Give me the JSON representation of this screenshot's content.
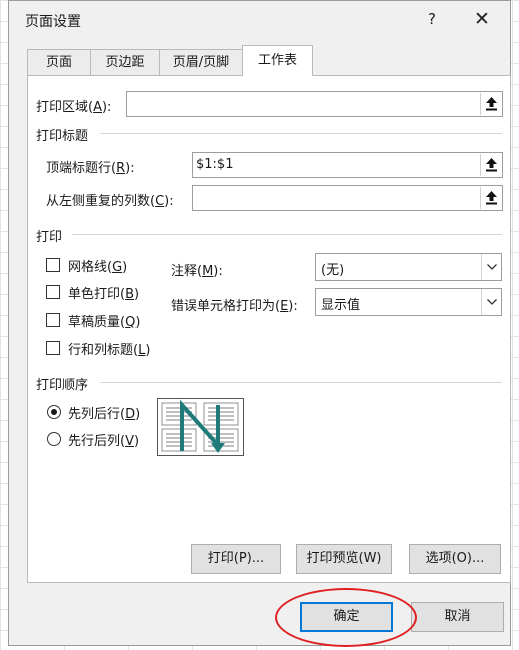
{
  "window": {
    "title": "页面设置",
    "help_label": "?",
    "close_label": "✕"
  },
  "tabs": [
    {
      "label": "页面",
      "active": false
    },
    {
      "label": "页边距",
      "active": false
    },
    {
      "label": "页眉/页脚",
      "active": false
    },
    {
      "label": "工作表",
      "active": true
    }
  ],
  "print_area": {
    "label": "打印区域(",
    "key": "A",
    "suffix": "):",
    "value": ""
  },
  "print_titles": {
    "heading": "打印标题",
    "rows_label": "顶端标题行(",
    "rows_key": "R",
    "rows_suffix": "):",
    "rows_value": "$1:$1",
    "cols_label": "从左侧重复的列数(",
    "cols_key": "C",
    "cols_suffix": "):",
    "cols_value": ""
  },
  "print": {
    "heading": "打印",
    "checkboxes": [
      {
        "label": "网格线(",
        "key": "G",
        "suffix": ")",
        "checked": false
      },
      {
        "label": "单色打印(",
        "key": "B",
        "suffix": ")",
        "checked": false
      },
      {
        "label": "草稿质量(",
        "key": "Q",
        "suffix": ")",
        "checked": false
      },
      {
        "label": "行和列标题(",
        "key": "L",
        "suffix": ")",
        "checked": false
      }
    ],
    "comments_label": "注释(",
    "comments_key": "M",
    "comments_suffix": "):",
    "comments_value": "(无)",
    "errors_label": "错误单元格打印为(",
    "errors_key": "E",
    "errors_suffix": "):",
    "errors_value": "显示值"
  },
  "page_order": {
    "heading": "打印顺序",
    "options": [
      {
        "label": "先列后行(",
        "key": "D",
        "suffix": ")",
        "selected": true
      },
      {
        "label": "先行后列(",
        "key": "V",
        "suffix": ")",
        "selected": false
      }
    ]
  },
  "buttons": {
    "print": "打印(P)...",
    "preview": "打印预览(W)",
    "options": "选项(O)...",
    "ok": "确定",
    "cancel": "取消"
  },
  "colors": {
    "accent": "#0078d7",
    "highlight_circle": "#e02020",
    "order_arrow": "#1f7a7a"
  },
  "icons": {
    "collapse": "collapse-dialog-icon",
    "dropdown": "chevron-down-icon",
    "order_preview": "page-order-preview-icon"
  }
}
